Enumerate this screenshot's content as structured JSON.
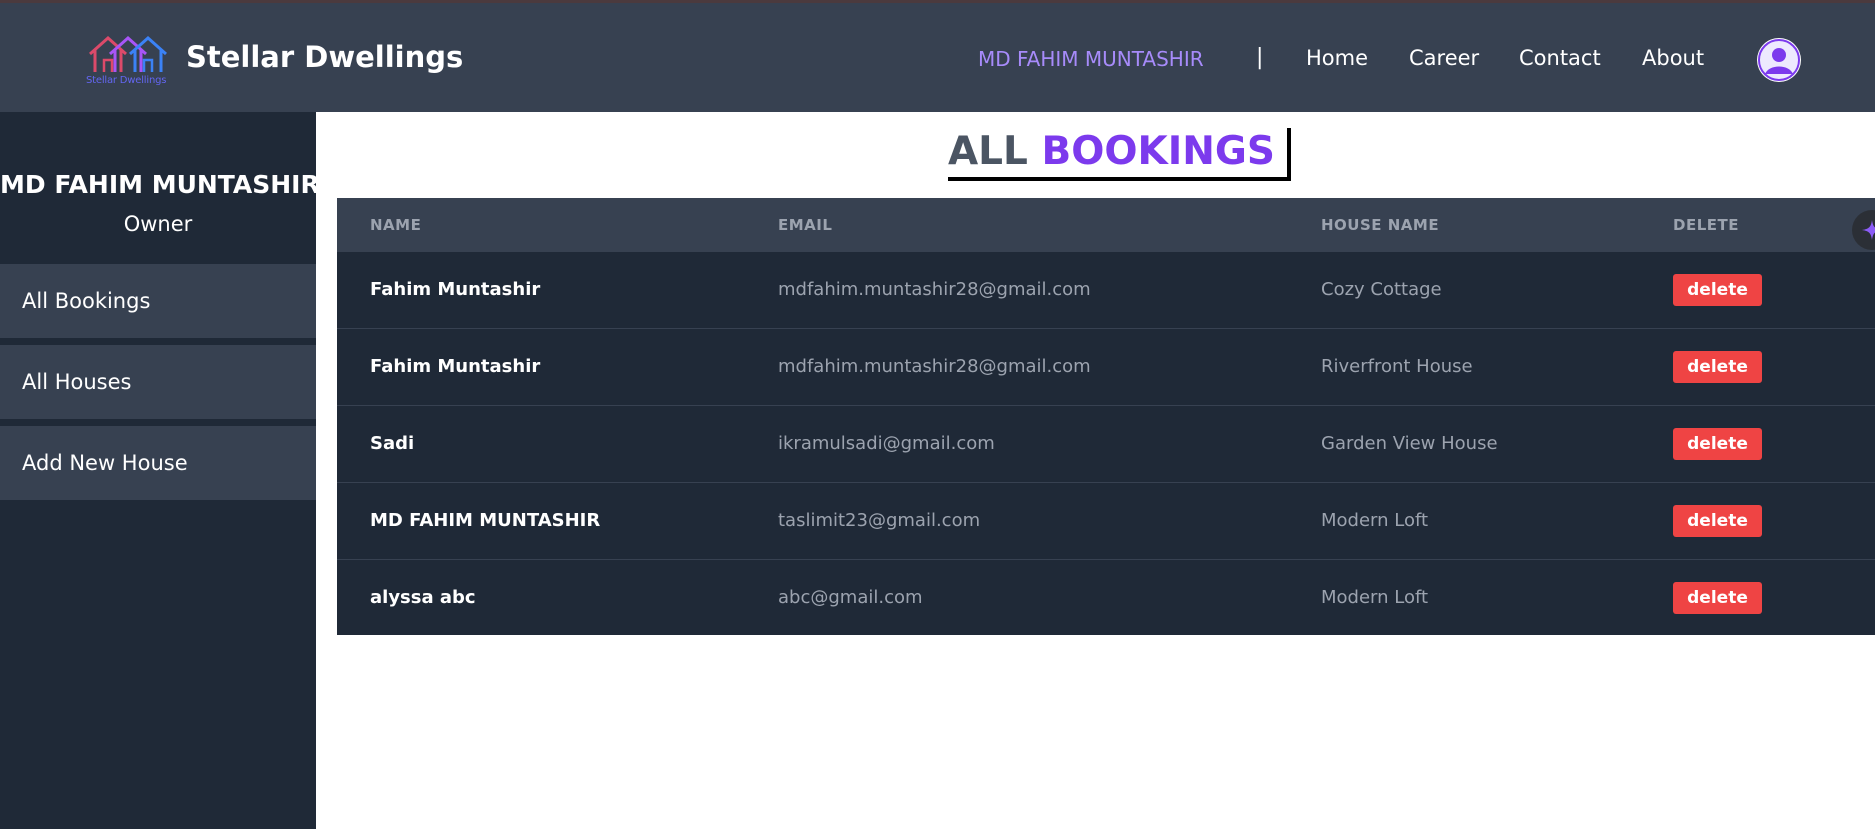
{
  "header": {
    "brand_name": "Stellar Dwellings",
    "logo_text": "Stellar Dwellings",
    "nav_user": "MD FAHIM MUNTASHIR",
    "nav_separator": "|",
    "nav_links": [
      "Home",
      "Career",
      "Contact",
      "About"
    ]
  },
  "sidebar": {
    "user_name": "MD FAHIM MUNTASHIR",
    "role": "Owner",
    "items": [
      "All Bookings",
      "All Houses",
      "Add New House"
    ]
  },
  "page": {
    "title_part1": "ALL",
    "title_part2": "BOOKINGS"
  },
  "table": {
    "headers": [
      "NAME",
      "EMAIL",
      "HOUSE NAME",
      "DELETE"
    ],
    "rows": [
      {
        "name": "Fahim Muntashir",
        "email": "mdfahim.muntashir28@gmail.com",
        "house": "Cozy Cottage",
        "action": "delete"
      },
      {
        "name": "Fahim Muntashir",
        "email": "mdfahim.muntashir28@gmail.com",
        "house": "Riverfront House",
        "action": "delete"
      },
      {
        "name": "Sadi",
        "email": "ikramulsadi@gmail.com",
        "house": "Garden View House",
        "action": "delete"
      },
      {
        "name": "MD FAHIM MUNTASHIR",
        "email": "taslimit23@gmail.com",
        "house": "Modern Loft",
        "action": "delete"
      },
      {
        "name": "alyssa abc",
        "email": "abc@gmail.com",
        "house": "Modern Loft",
        "action": "delete"
      }
    ]
  },
  "colors": {
    "header_bg": "#374151",
    "sidebar_bg": "#1f2937",
    "accent_purple": "#7c3aed",
    "delete_red": "#ef4444"
  },
  "icons": [
    "house-logo-icon",
    "user-avatar-icon",
    "sparkle-icon"
  ]
}
